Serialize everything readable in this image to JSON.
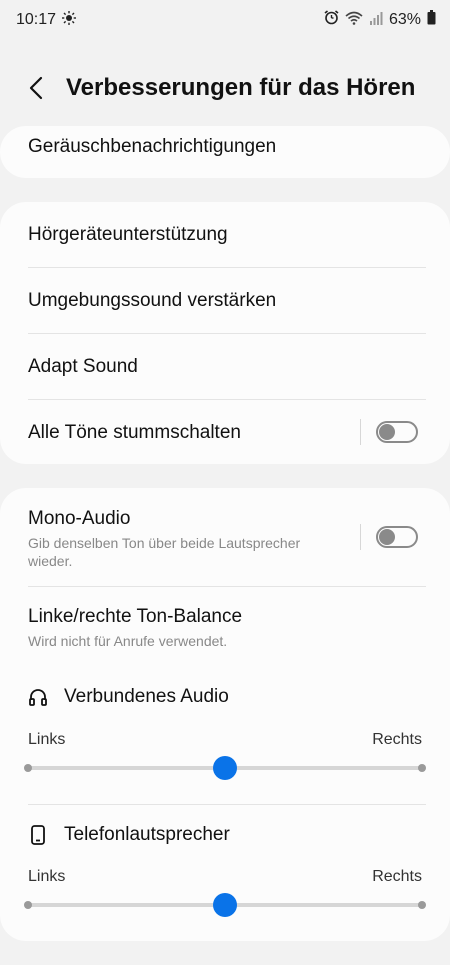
{
  "status_bar": {
    "time": "10:17",
    "battery": "63%"
  },
  "header": {
    "title": "Verbesserungen für das Hören"
  },
  "card1": {
    "item": "Geräuschbenachrichtigungen"
  },
  "card2": {
    "items": [
      {
        "label": "Hörgeräteunterstützung"
      },
      {
        "label": "Umgebungssound verstärken"
      },
      {
        "label": "Adapt Sound"
      },
      {
        "label": "Alle Töne stummschalten",
        "toggle": false
      }
    ]
  },
  "card3": {
    "mono_audio": {
      "label": "Mono-Audio",
      "sub": "Gib denselben Ton über beide Lautsprecher wieder.",
      "toggle": false
    },
    "balance": {
      "label": "Linke/rechte Ton-Balance",
      "sub": "Wird nicht für Anrufe verwendet."
    },
    "connected_audio": {
      "label": "Verbundenes Audio",
      "left": "Links",
      "right": "Rechts",
      "value": 0.5
    },
    "phone_speaker": {
      "label": "Telefonlautsprecher",
      "left": "Links",
      "right": "Rechts",
      "value": 0.5
    }
  },
  "colors": {
    "accent": "#0a73e8",
    "background": "#f2f2f2",
    "card": "#fcfcfc"
  }
}
